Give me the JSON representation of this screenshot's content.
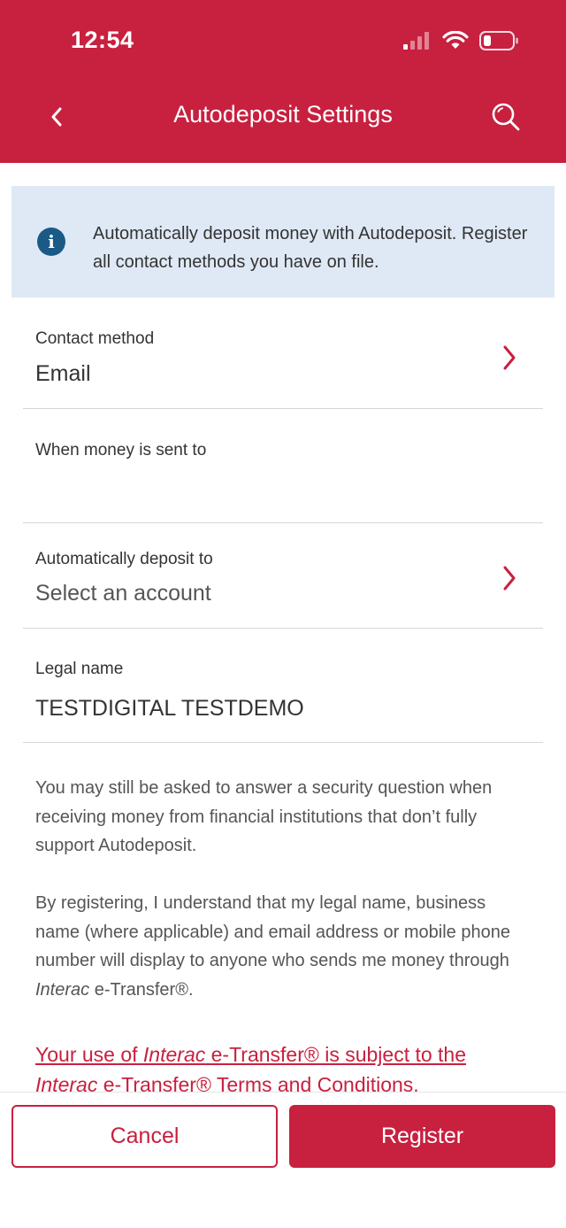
{
  "status_bar": {
    "time": "12:54",
    "icons": [
      "cellular-signal-icon",
      "wifi-icon",
      "battery-low-icon"
    ],
    "battery_color": "#ff3b30"
  },
  "nav": {
    "title": "Autodeposit Settings",
    "back_icon": "chevron-left-icon",
    "search_icon": "search-icon"
  },
  "info_banner": {
    "icon": "info-icon",
    "text": "Automatically deposit money with Autodeposit. Register all contact methods you have on file."
  },
  "form": {
    "contact_method": {
      "label": "Contact method",
      "value": "Email"
    },
    "when_money_sent": {
      "label": "When money is sent to",
      "value": ""
    },
    "deposit_to": {
      "label": "Automatically deposit to",
      "value": "Select an account"
    },
    "legal_name": {
      "label": "Legal name",
      "value": "TESTDIGITAL TESTDEMO"
    }
  },
  "disclaimers": {
    "security": "You may still be asked to answer a security question when receiving money from financial institutions that don’t fully support Autodeposit.",
    "registration_before": "By registering, I understand that my legal name, business name (where applicable) and email address or mobile phone number will display to anyone who sends me money through ",
    "registration_brand": "Interac",
    "registration_after": " e-Transfer®."
  },
  "terms": {
    "part1": "Your use of ",
    "brand1": "Interac",
    "part2": " e-Transfer® is subject to the ",
    "brand2": "Interac",
    "part3": " e-Transfer® Terms and Conditions."
  },
  "footer": {
    "cancel_label": "Cancel",
    "register_label": "Register"
  },
  "colors": {
    "brand": "#c8203f",
    "info_background": "#dfe9f5",
    "info_icon": "#1b5a86"
  }
}
